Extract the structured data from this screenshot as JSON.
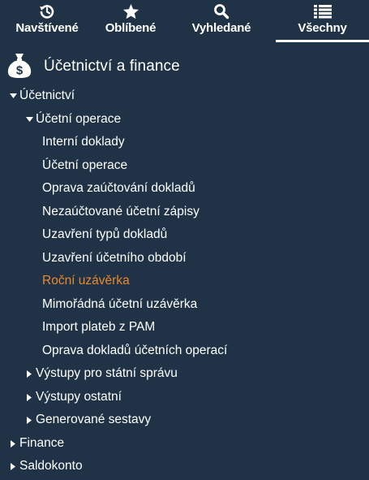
{
  "tabs": [
    {
      "label": "Navštívené",
      "icon": "history-icon"
    },
    {
      "label": "Oblíbené",
      "icon": "star-icon"
    },
    {
      "label": "Vyhledané",
      "icon": "search-icon"
    },
    {
      "label": "Všechny",
      "icon": "list-icon",
      "active": true
    }
  ],
  "section": {
    "title": "Účetnictví a finance",
    "icon": "money-bag-icon"
  },
  "tree": {
    "ucetnictvi": "Účetnictví",
    "ucetni_operace_group": "Účetní operace",
    "leaves": [
      "Interní doklady",
      "Účetní operace",
      "Oprava zaúčtování dokladů",
      "Nezaúčtované účetní zápisy",
      "Uzavření typů dokladů",
      "Uzavření účetního období",
      "Roční uzávěrka",
      "Mimořádná účetní uzávěrka",
      "Import plateb z PAM",
      "Oprava dokladů účetních operací"
    ],
    "active_leaf": "Roční uzávěrka",
    "subgroups": [
      "Výstupy pro státní správu",
      "Výstupy ostatní",
      "Generované sestavy"
    ],
    "finance": "Finance",
    "saldokonto": "Saldokonto"
  },
  "colors": {
    "background": "#1f3246",
    "text": "#ffffff",
    "active_item": "#e8892e"
  }
}
